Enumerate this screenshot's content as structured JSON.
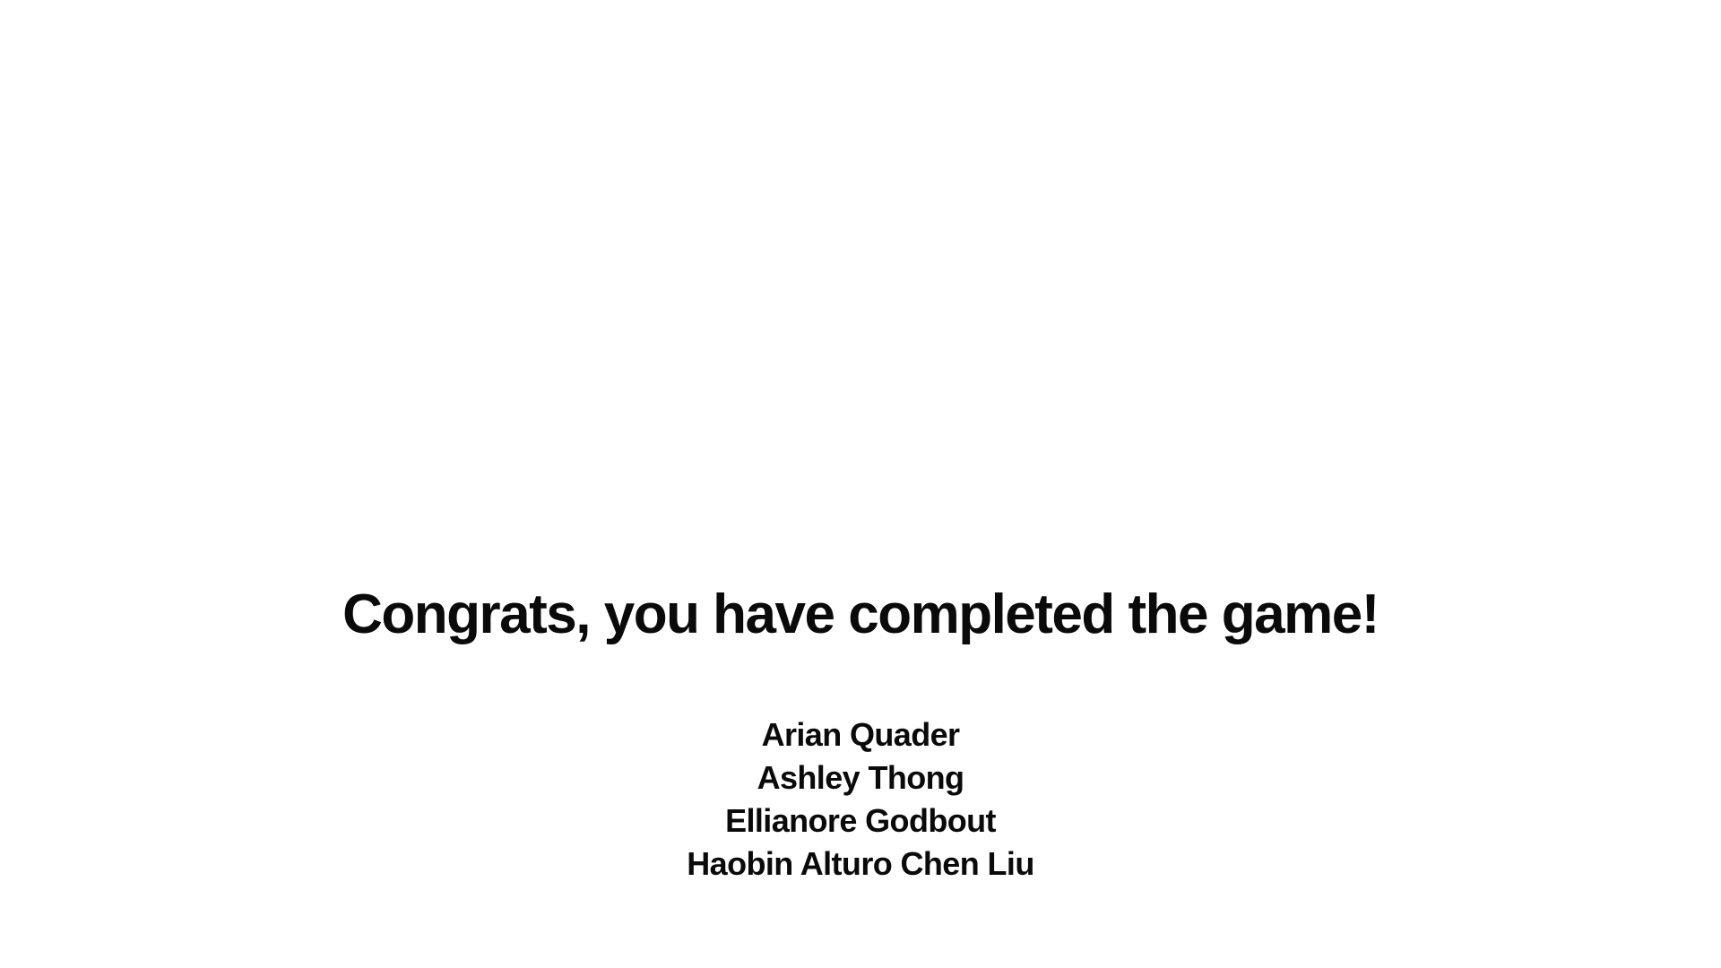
{
  "end_screen": {
    "headline": "Congrats, you have completed the game!",
    "credits": [
      "Arian Quader",
      "Ashley Thong",
      "Ellianore Godbout",
      "Haobin Alturo Chen Liu"
    ]
  },
  "colors": {
    "background": "#ffffff",
    "text": "#0a0a0a"
  }
}
